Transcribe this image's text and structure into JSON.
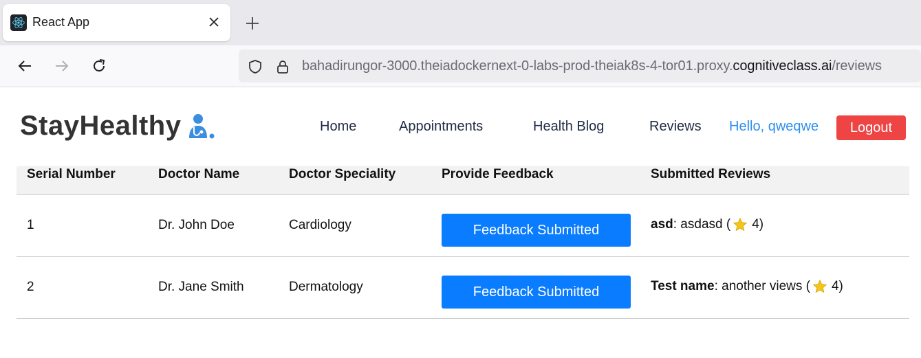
{
  "browser": {
    "tab_title": "React App",
    "url_prefix": "bahadirungor-3000.theiadockernext-0-labs-prod-theiak8s-4-tor01.proxy.",
    "url_domain": "cognitiveclass.ai",
    "url_path": "/reviews"
  },
  "header": {
    "brand": "StayHealthy",
    "nav": [
      "Home",
      "Appointments",
      "Health Blog",
      "Reviews"
    ],
    "greeting": "Hello, qweqwe",
    "logout_label": "Logout"
  },
  "table": {
    "columns": [
      "Serial Number",
      "Doctor Name",
      "Doctor Speciality",
      "Provide Feedback",
      "Submitted Reviews"
    ],
    "rows": [
      {
        "serial": "1",
        "doctor": "Dr. John Doe",
        "speciality": "Cardiology",
        "button": "Feedback Submitted",
        "review_name": "asd",
        "review_text": ": asdasd (",
        "rating": "4)"
      },
      {
        "serial": "2",
        "doctor": "Dr. Jane Smith",
        "speciality": "Dermatology",
        "button": "Feedback Submitted",
        "review_name": "Test name",
        "review_text": ": another views (",
        "rating": "4)"
      }
    ]
  },
  "colors": {
    "accent": "#0a7cff",
    "logout": "#ef4444",
    "greeting": "#2b8ff0",
    "star": "#f5c518"
  },
  "icons": [
    "react-favicon-icon",
    "close-icon",
    "plus-icon",
    "back-arrow-icon",
    "forward-arrow-icon",
    "reload-icon",
    "shield-icon",
    "lock-icon",
    "doctor-icon",
    "star-icon"
  ]
}
